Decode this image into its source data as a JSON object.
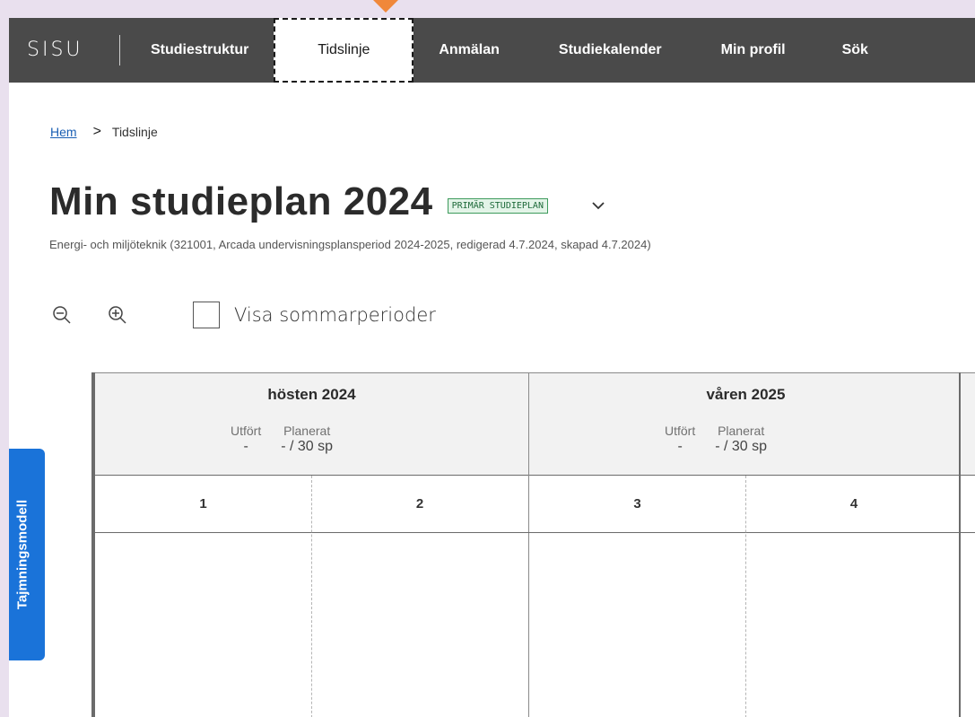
{
  "nav": {
    "logo": "SISU",
    "items": [
      {
        "label": "Studiestruktur",
        "active": false
      },
      {
        "label": "Tidslinje",
        "active": true
      },
      {
        "label": "Anmälan",
        "active": false
      },
      {
        "label": "Studiekalender",
        "active": false
      },
      {
        "label": "Min profil",
        "active": false
      },
      {
        "label": "Sök",
        "active": false
      }
    ]
  },
  "breadcrumb": {
    "home": "Hem",
    "separator": ">",
    "current": "Tidslinje"
  },
  "plan": {
    "title": "Min studieplan 2024",
    "badge": "PRIMÄR STUDIEPLAN",
    "subtitle": "Energi- och miljöteknik (321001, Arcada undervisningsplansperiod 2024-2025, redigerad 4.7.2024, skapad 4.7.2024)"
  },
  "toolbar": {
    "summer_checkbox_label": "Visa sommarperioder",
    "summer_checked": false
  },
  "timeline": {
    "terms": [
      {
        "name": "hösten 2024",
        "done_label": "Utfört",
        "done_value": "-",
        "planned_label": "Planerat",
        "planned_value": "- / 30 sp"
      },
      {
        "name": "våren 2025",
        "done_label": "Utfört",
        "done_value": "-",
        "planned_label": "Planerat",
        "planned_value": "- / 30 sp"
      }
    ],
    "periods": [
      "1",
      "2",
      "3",
      "4"
    ]
  },
  "side_tab": {
    "label": "Tajmningsmodell"
  },
  "colors": {
    "navbar": "#4a4a4a",
    "accent_blue": "#1a73d9",
    "badge_green": "#3d9a5c",
    "marker_orange": "#f0883a",
    "page_bg": "#e9e0ee"
  },
  "icons": {
    "zoom_out": "zoom-out-icon",
    "zoom_in": "zoom-in-icon",
    "dropdown": "chevron-down-icon"
  }
}
